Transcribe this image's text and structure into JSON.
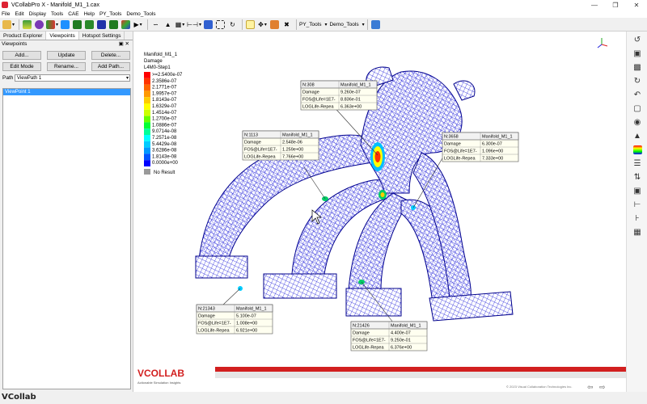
{
  "window": {
    "title": "VCollabPro X - Manifold_M1_1.cax"
  },
  "menu": [
    "File",
    "Edit",
    "Display",
    "Tools",
    "CAE",
    "Help",
    "PY_Tools",
    "Demo_Tools"
  ],
  "toolbar": {
    "py_tools_label": "PY_Tools",
    "demo_tools_label": "Demo_Tools"
  },
  "left_panel": {
    "tabs": [
      "Product Explorer",
      "Viewpoints",
      "Hotspot Settings"
    ],
    "active_tab": "Viewpoints",
    "panel_title": "Viewpoints",
    "buttons_row1": [
      "Add...",
      "Update",
      "Delete..."
    ],
    "buttons_row2": [
      "Edit Mode",
      "Rename...",
      "Add Path..."
    ],
    "path_label": "Path",
    "path_value": "ViewPath 1",
    "list_items": [
      "ViewPoint 1"
    ]
  },
  "legend": {
    "model": "Manifold_M1_1",
    "quantity": "Damage",
    "step": "L4M0-Step1",
    "values": [
      ">=2.5400e-07",
      "2.3586e-07",
      "2.1771e-07",
      "1.9957e-07",
      "1.8143e-07",
      "1.6329e-07",
      "1.4514e-07",
      "1.2700e-07",
      "1.0886e-07",
      "9.0714e-08",
      "7.2571e-08",
      "5.4429e-08",
      "3.6286e-08",
      "1.8143e-08",
      "0.0000e+00"
    ],
    "colors": [
      "#ff0000",
      "#ff3300",
      "#ff6600",
      "#ff9900",
      "#ffcc00",
      "#ffff00",
      "#ccff00",
      "#66ff00",
      "#00ff33",
      "#00ff99",
      "#00ffff",
      "#00ccff",
      "#0099ff",
      "#0055ff",
      "#0000ff"
    ],
    "no_result_label": "No Result",
    "no_result_color": "#9a9a9a"
  },
  "probes": [
    {
      "node": "N:308",
      "model": "Manifold_M1_1",
      "rows": [
        {
          "k": "Damage",
          "v": "9.260e-07"
        },
        {
          "k": "FOS@Life=1E7-",
          "v": "8.836e-01"
        },
        {
          "k": "LOGLife-Repea",
          "v": "6.363e+00"
        }
      ]
    },
    {
      "node": "N:1113",
      "model": "Manifold_M1_1",
      "rows": [
        {
          "k": "Damage",
          "v": "2.548e-06"
        },
        {
          "k": "FOS@Life=1E7-",
          "v": "1.259e+00"
        },
        {
          "k": "LOGLife-Repea",
          "v": "7.766e+00"
        }
      ]
    },
    {
      "node": "N:3658",
      "model": "Manifold_M1_1",
      "rows": [
        {
          "k": "Damage",
          "v": "6.300e-07"
        },
        {
          "k": "FOS@Life=1E7-",
          "v": "1.096e+00"
        },
        {
          "k": "LOGLife-Repea",
          "v": "7.333e+00"
        }
      ]
    },
    {
      "node": "N:21343",
      "model": "Manifold_M1_1",
      "rows": [
        {
          "k": "Damage",
          "v": "5.100e-07"
        },
        {
          "k": "FOS@Life=1E7-",
          "v": "1.008e+00"
        },
        {
          "k": "LOGLife-Repea",
          "v": "6.921e+00"
        }
      ]
    },
    {
      "node": "N:21426",
      "model": "Manifold_M1_1",
      "rows": [
        {
          "k": "Damage",
          "v": "4.400e-07"
        },
        {
          "k": "FOS@Life=1E7-",
          "v": "9.250e-01"
        },
        {
          "k": "LOGLife-Repea",
          "v": "6.376e+00"
        }
      ]
    }
  ],
  "branding": {
    "logo": "VCOLLAB",
    "tagline": "Actionable Simulation Insights",
    "copyright": "© 2023 Visual Collaboration Technologies Inc.",
    "watermark": "VCollab"
  },
  "colors": {
    "mesh": "#1a1ad9",
    "mesh_dark": "#00008b",
    "brand_red": "#d21f1f",
    "selection": "#3399ff",
    "probe_bg": "#fffff0"
  }
}
